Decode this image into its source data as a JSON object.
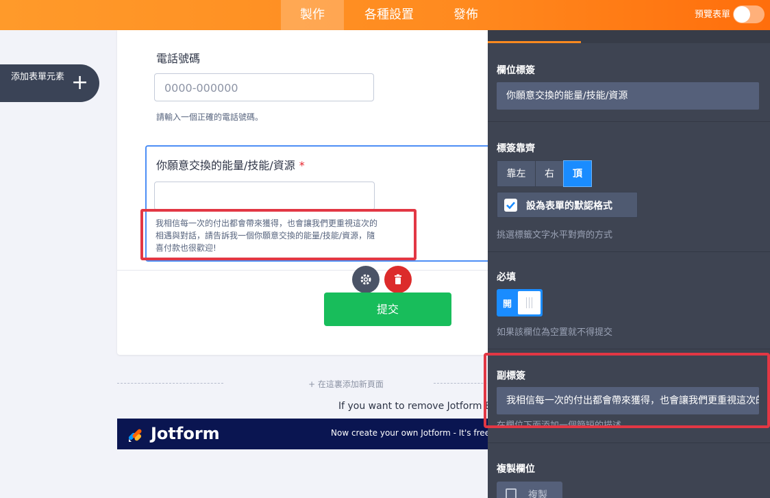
{
  "topbar": {
    "tabs": [
      {
        "label": "製作",
        "active": true
      },
      {
        "label": "各種設置",
        "active": false
      },
      {
        "label": "發佈",
        "active": false
      }
    ],
    "preview_label": "預覽表單"
  },
  "sidebar": {
    "add_element_label": "添加表單元素"
  },
  "form": {
    "phone": {
      "label": "電話號碼",
      "placeholder": "0000-000000",
      "help": "請輸入一個正確的電話號碼。"
    },
    "question": {
      "label": "你願意交換的能量/技能/資源",
      "required_mark": "*",
      "sublabel": "我相信每一次的付出都會帶來獲得，也會讓我們更重視這次的相遇與對話，請告訴我一個你願意交換的能量/技能/資源，隨喜付款也很歡迎!"
    },
    "submit_label": "提交",
    "add_page_label": "+ 在這裏添加新頁面",
    "remove_branding_text": "If you want to remove Jotform Br",
    "banner": {
      "brand": "Jotform",
      "cta": "Now create your own Jotform - It's free"
    }
  },
  "panel": {
    "field_label_title": "欄位標簽",
    "field_label_value": "你願意交換的能量/技能/資源",
    "label_align_title": "標簽靠齊",
    "align_options": [
      {
        "label": "靠左",
        "active": false
      },
      {
        "label": "右",
        "active": false
      },
      {
        "label": "頂",
        "active": true
      }
    ],
    "default_checkbox_label": "設為表單的默認格式",
    "align_help": "挑選標籤文字水平對齊的方式",
    "required_title": "必填",
    "required_toggle_label": "開",
    "required_help": "如果該欄位為空置就不得提交",
    "sublabel_title": "副標簽",
    "sublabel_value": "我相信每一次的付出都會帶來獲得，也會讓我們更重視這次的相遇與對話",
    "sublabel_help": "在欄位下面添加一個簡短的描述",
    "duplicate_title": "複製欄位",
    "duplicate_button": "複製"
  },
  "colors": {
    "accent_orange": "#ff8a1f",
    "active_blue": "#1a8cff",
    "submit_green": "#18bd5b",
    "delete_red": "#dc2b2b",
    "highlight_red": "#e23744",
    "panel_bg": "#3e4452"
  }
}
